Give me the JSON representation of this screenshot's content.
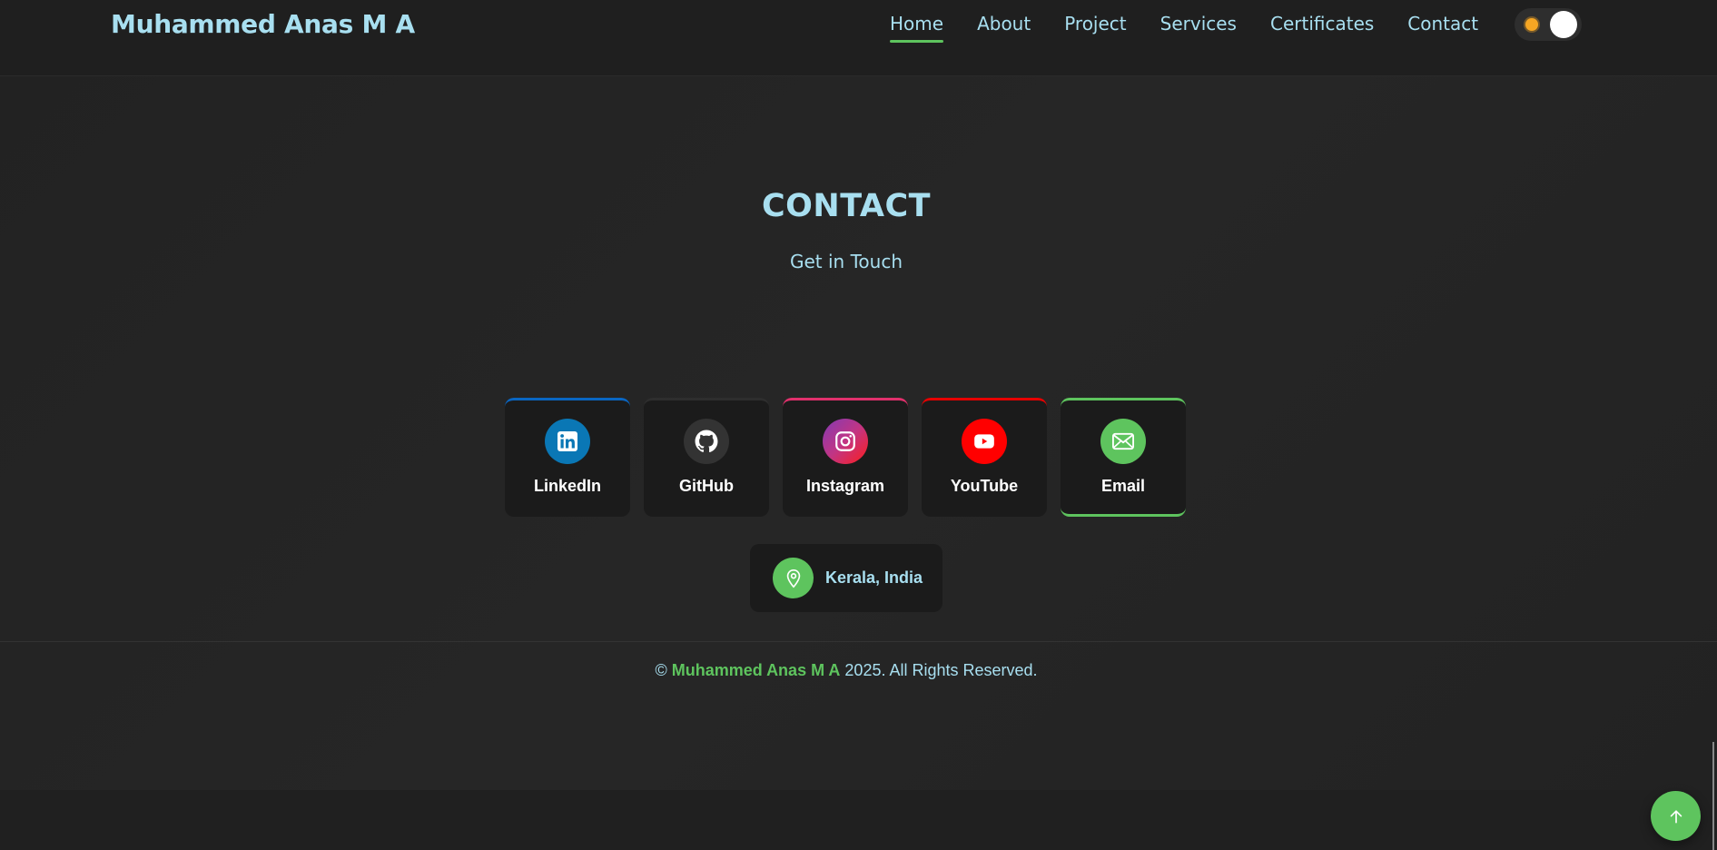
{
  "header": {
    "brand": "Muhammed Anas M A",
    "nav": [
      {
        "label": "Home",
        "active": true
      },
      {
        "label": "About",
        "active": false
      },
      {
        "label": "Project",
        "active": false
      },
      {
        "label": "Services",
        "active": false
      },
      {
        "label": "Certificates",
        "active": false
      },
      {
        "label": "Contact",
        "active": false
      }
    ],
    "theme_toggle": {
      "icon": "sun-icon",
      "state": "light"
    }
  },
  "contact": {
    "title": "CONTACT",
    "subtitle": "Get in Touch",
    "cards": [
      {
        "label": "LinkedIn",
        "icon": "linkedin-icon",
        "accent": "#0a66c2",
        "icon_bg": "#0a77b5"
      },
      {
        "label": "GitHub",
        "icon": "github-icon",
        "accent": "#2e2e2e",
        "icon_bg": "#333333"
      },
      {
        "label": "Instagram",
        "icon": "instagram-icon",
        "accent": "#e1306c",
        "icon_bg": "#c13584"
      },
      {
        "label": "YouTube",
        "icon": "youtube-icon",
        "accent": "#e60000",
        "icon_bg": "#ff0000"
      },
      {
        "label": "Email",
        "icon": "mail-icon",
        "accent": "#5ec45e",
        "icon_bg": "#5ec45e"
      }
    ],
    "location": {
      "icon": "location-pin-icon",
      "text": "Kerala, India"
    }
  },
  "footer": {
    "prefix": "©",
    "name": "Muhammed Anas M A",
    "suffix": "2025. All Rights Reserved."
  },
  "scroll_top": {
    "icon": "arrow-up-icon"
  },
  "colors": {
    "accent_green": "#5ec45e",
    "text_cyan": "#a8dff0",
    "background": "#232323"
  }
}
